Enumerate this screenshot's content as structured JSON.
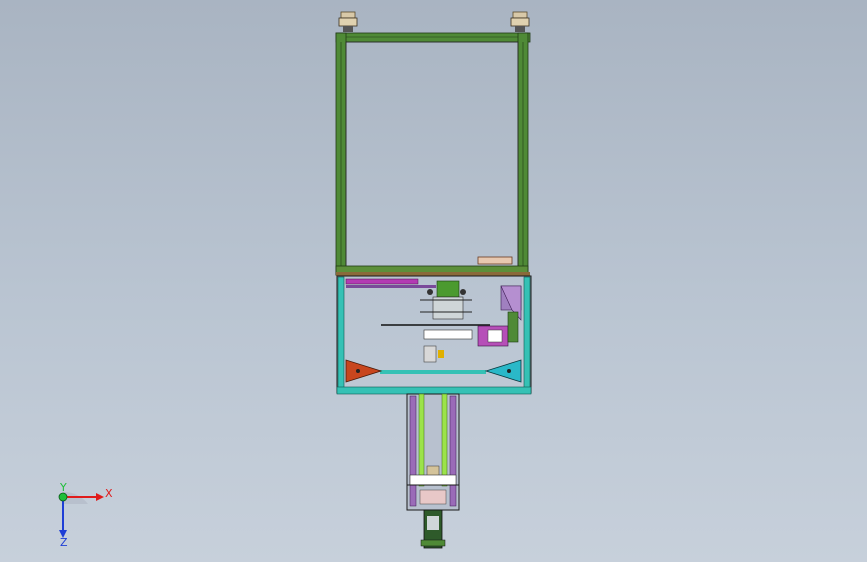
{
  "viewport": {
    "background_top": "#a9b4c2",
    "background_bottom": "#c7d0db"
  },
  "triad": {
    "x_label": "X",
    "y_label": "Y",
    "z_label": "Z",
    "x_color": "#e01b1b",
    "y_color": "#1fbf3a",
    "z_color": "#1f3fd6"
  },
  "model": {
    "frame_color": "#3f7a2c",
    "base_outline_color": "#2ec6b8",
    "left_arm_color": "#c8461e",
    "right_arm_color": "#2ab8c8",
    "rail_color": "#9be34a",
    "panel_color": "#9a6bb8"
  }
}
